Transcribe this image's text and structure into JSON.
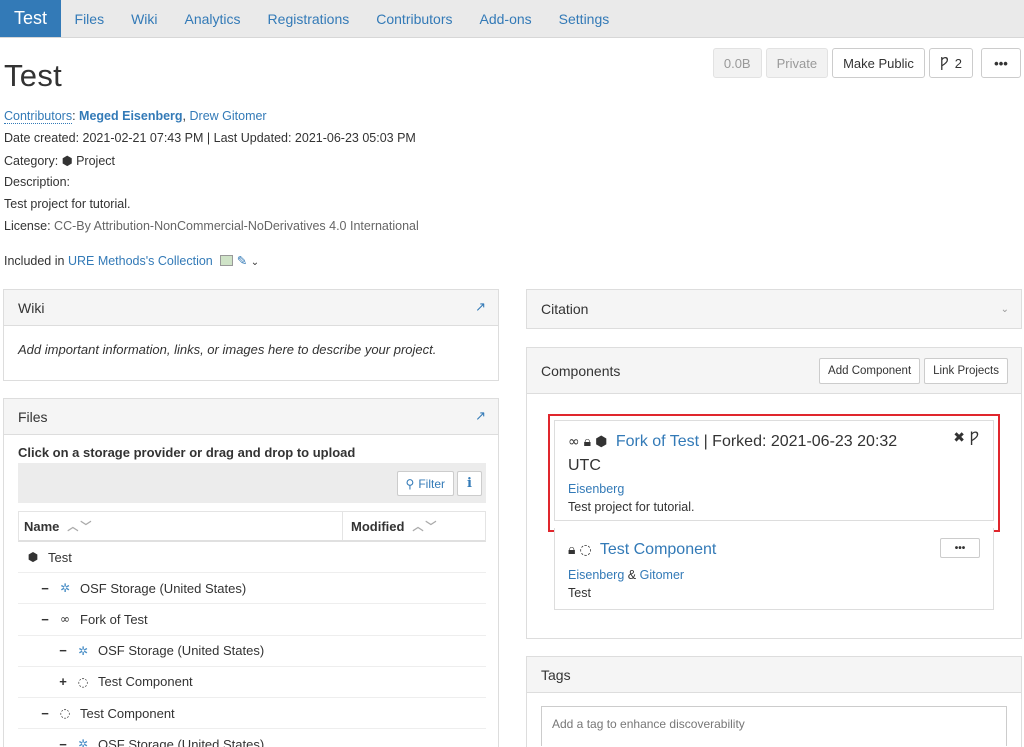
{
  "nav": {
    "brand": "Test",
    "links": [
      "Files",
      "Wiki",
      "Analytics",
      "Registrations",
      "Contributors",
      "Add-ons",
      "Settings"
    ]
  },
  "header": {
    "title": "Test",
    "size_label": "0.0B",
    "private_label": "Private",
    "make_public_label": "Make Public",
    "forks_count": "2",
    "more_label": "•••"
  },
  "meta": {
    "contributors_label": "Contributors",
    "contributor_1": "Meged Eisenberg",
    "contributor_2": "Drew Gitomer",
    "dates": "Date created: 2021-02-21 07:43 PM | Last Updated: 2021-06-23 05:03 PM",
    "category_label": "Category:",
    "category_value": "Project",
    "description_label": "Description:",
    "description_value": "Test project for tutorial.",
    "license_label": "License:",
    "license_value": "CC-By Attribution-NonCommercial-NoDerivatives 4.0 International",
    "included_label": "Included in",
    "collection_name": "URE Methods's Collection"
  },
  "wiki": {
    "title": "Wiki",
    "body": "Add important information, links, or images here to describe your project."
  },
  "files": {
    "title": "Files",
    "instructions": "Click on a storage provider or drag and drop to upload",
    "filter_label": "Filter",
    "info_label": "i",
    "col_name": "Name",
    "col_modified": "Modified",
    "rows": [
      {
        "toggle": "",
        "icon": "cube",
        "label": "Test"
      },
      {
        "toggle": "−",
        "icon": "gear",
        "label": "OSF Storage (United States)"
      },
      {
        "toggle": "−",
        "icon": "link",
        "label": "Fork of Test"
      },
      {
        "toggle": "−",
        "icon": "gear",
        "label": "OSF Storage (United States)"
      },
      {
        "toggle": "+",
        "icon": "circle-notch",
        "label": "Test Component"
      },
      {
        "toggle": "−",
        "icon": "circle-notch",
        "label": "Test Component"
      },
      {
        "toggle": "−",
        "icon": "gear",
        "label": "OSF Storage (United States)"
      }
    ]
  },
  "citation": {
    "title": "Citation"
  },
  "components": {
    "title": "Components",
    "add_label": "Add Component",
    "link_label": "Link Projects",
    "items": [
      {
        "title": "Fork of Test",
        "suffix": "| Forked: 2021-06-23 20:32 UTC",
        "contributors": "Eisenberg",
        "description": "Test project for tutorial."
      },
      {
        "title": "Test Component",
        "contributor_1": "Eisenberg",
        "amp": "&",
        "contributor_2": "Gitomer",
        "description": "Test"
      }
    ]
  },
  "tags": {
    "title": "Tags",
    "placeholder": "Add a tag to enhance discoverability"
  },
  "colors": {
    "accent": "#337ab7",
    "highlight": "#e0262d"
  }
}
